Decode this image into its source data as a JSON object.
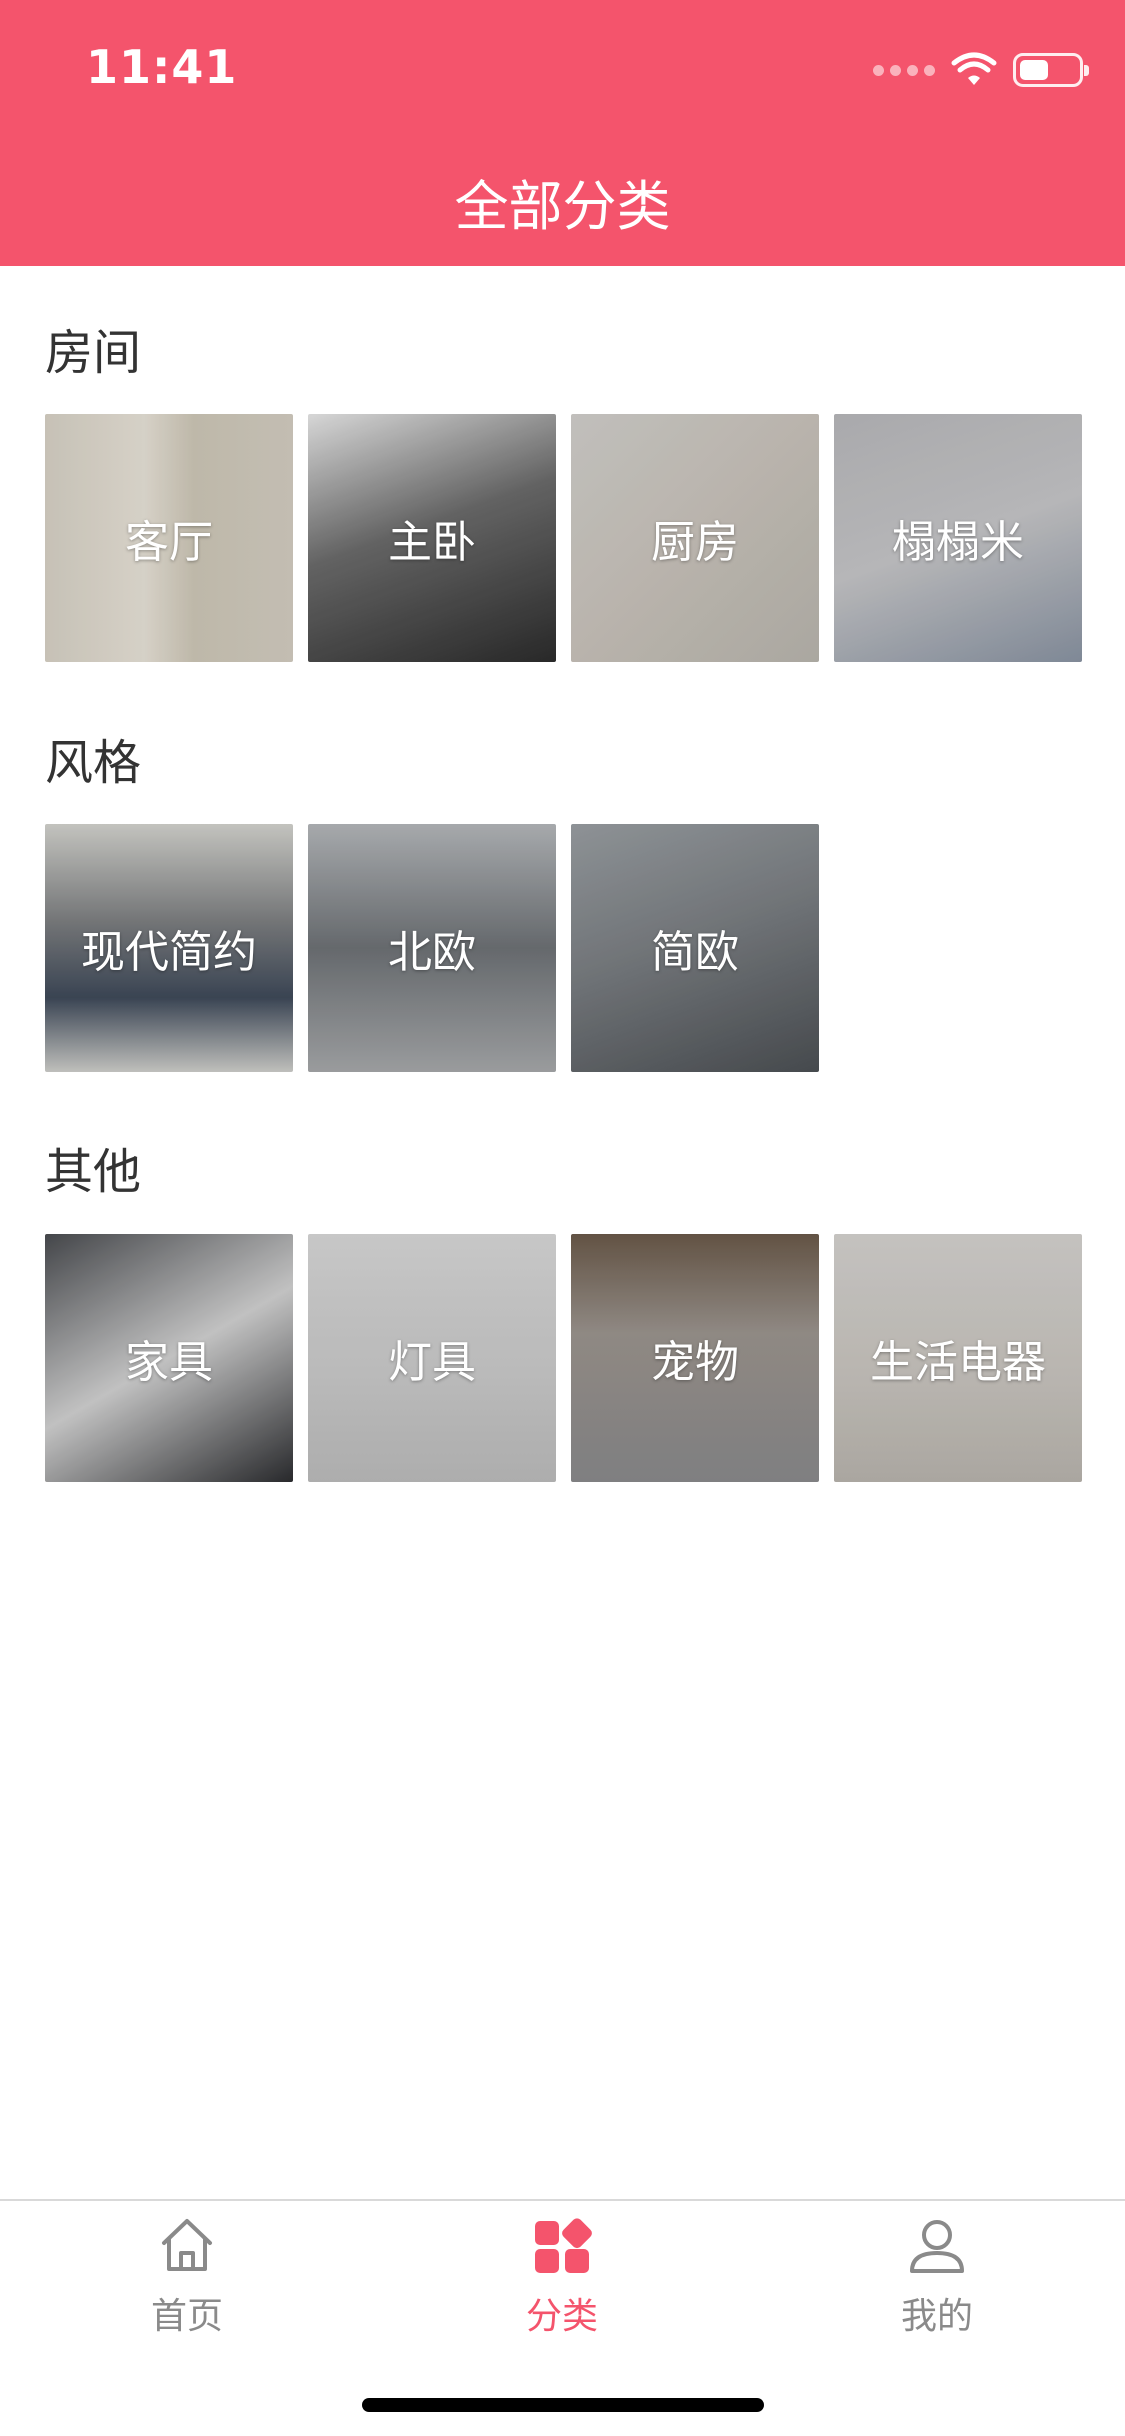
{
  "status": {
    "time": "11:41"
  },
  "header": {
    "title": "全部分类",
    "color": "#f4546c"
  },
  "sections": [
    {
      "title": "房间",
      "items": [
        "客厅",
        "主卧",
        "厨房",
        "榻榻米"
      ]
    },
    {
      "title": "风格",
      "items": [
        "现代简约",
        "北欧",
        "简欧"
      ]
    },
    {
      "title": "其他",
      "items": [
        "家具",
        "灯具",
        "宠物",
        "生活电器"
      ]
    }
  ],
  "tabs": [
    {
      "label": "首页",
      "icon": "home-icon",
      "active": false
    },
    {
      "label": "分类",
      "icon": "category-icon",
      "active": true
    },
    {
      "label": "我的",
      "icon": "user-icon",
      "active": false
    }
  ]
}
